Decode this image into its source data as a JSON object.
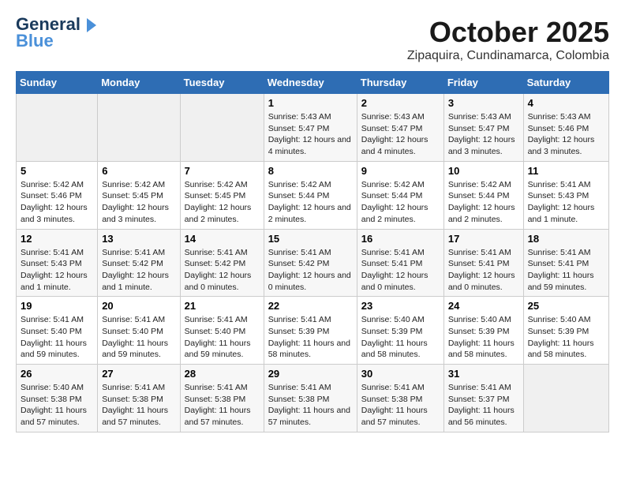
{
  "header": {
    "logo_line1": "General",
    "logo_line2": "Blue",
    "month_title": "October 2025",
    "location": "Zipaquira, Cundinamarca, Colombia"
  },
  "weekdays": [
    "Sunday",
    "Monday",
    "Tuesday",
    "Wednesday",
    "Thursday",
    "Friday",
    "Saturday"
  ],
  "weeks": [
    [
      {
        "day": "",
        "sunrise": "",
        "sunset": "",
        "daylight": ""
      },
      {
        "day": "",
        "sunrise": "",
        "sunset": "",
        "daylight": ""
      },
      {
        "day": "",
        "sunrise": "",
        "sunset": "",
        "daylight": ""
      },
      {
        "day": "1",
        "sunrise": "Sunrise: 5:43 AM",
        "sunset": "Sunset: 5:47 PM",
        "daylight": "Daylight: 12 hours and 4 minutes."
      },
      {
        "day": "2",
        "sunrise": "Sunrise: 5:43 AM",
        "sunset": "Sunset: 5:47 PM",
        "daylight": "Daylight: 12 hours and 4 minutes."
      },
      {
        "day": "3",
        "sunrise": "Sunrise: 5:43 AM",
        "sunset": "Sunset: 5:47 PM",
        "daylight": "Daylight: 12 hours and 3 minutes."
      },
      {
        "day": "4",
        "sunrise": "Sunrise: 5:43 AM",
        "sunset": "Sunset: 5:46 PM",
        "daylight": "Daylight: 12 hours and 3 minutes."
      }
    ],
    [
      {
        "day": "5",
        "sunrise": "Sunrise: 5:42 AM",
        "sunset": "Sunset: 5:46 PM",
        "daylight": "Daylight: 12 hours and 3 minutes."
      },
      {
        "day": "6",
        "sunrise": "Sunrise: 5:42 AM",
        "sunset": "Sunset: 5:45 PM",
        "daylight": "Daylight: 12 hours and 3 minutes."
      },
      {
        "day": "7",
        "sunrise": "Sunrise: 5:42 AM",
        "sunset": "Sunset: 5:45 PM",
        "daylight": "Daylight: 12 hours and 2 minutes."
      },
      {
        "day": "8",
        "sunrise": "Sunrise: 5:42 AM",
        "sunset": "Sunset: 5:44 PM",
        "daylight": "Daylight: 12 hours and 2 minutes."
      },
      {
        "day": "9",
        "sunrise": "Sunrise: 5:42 AM",
        "sunset": "Sunset: 5:44 PM",
        "daylight": "Daylight: 12 hours and 2 minutes."
      },
      {
        "day": "10",
        "sunrise": "Sunrise: 5:42 AM",
        "sunset": "Sunset: 5:44 PM",
        "daylight": "Daylight: 12 hours and 2 minutes."
      },
      {
        "day": "11",
        "sunrise": "Sunrise: 5:41 AM",
        "sunset": "Sunset: 5:43 PM",
        "daylight": "Daylight: 12 hours and 1 minute."
      }
    ],
    [
      {
        "day": "12",
        "sunrise": "Sunrise: 5:41 AM",
        "sunset": "Sunset: 5:43 PM",
        "daylight": "Daylight: 12 hours and 1 minute."
      },
      {
        "day": "13",
        "sunrise": "Sunrise: 5:41 AM",
        "sunset": "Sunset: 5:42 PM",
        "daylight": "Daylight: 12 hours and 1 minute."
      },
      {
        "day": "14",
        "sunrise": "Sunrise: 5:41 AM",
        "sunset": "Sunset: 5:42 PM",
        "daylight": "Daylight: 12 hours and 0 minutes."
      },
      {
        "day": "15",
        "sunrise": "Sunrise: 5:41 AM",
        "sunset": "Sunset: 5:42 PM",
        "daylight": "Daylight: 12 hours and 0 minutes."
      },
      {
        "day": "16",
        "sunrise": "Sunrise: 5:41 AM",
        "sunset": "Sunset: 5:41 PM",
        "daylight": "Daylight: 12 hours and 0 minutes."
      },
      {
        "day": "17",
        "sunrise": "Sunrise: 5:41 AM",
        "sunset": "Sunset: 5:41 PM",
        "daylight": "Daylight: 12 hours and 0 minutes."
      },
      {
        "day": "18",
        "sunrise": "Sunrise: 5:41 AM",
        "sunset": "Sunset: 5:41 PM",
        "daylight": "Daylight: 11 hours and 59 minutes."
      }
    ],
    [
      {
        "day": "19",
        "sunrise": "Sunrise: 5:41 AM",
        "sunset": "Sunset: 5:40 PM",
        "daylight": "Daylight: 11 hours and 59 minutes."
      },
      {
        "day": "20",
        "sunrise": "Sunrise: 5:41 AM",
        "sunset": "Sunset: 5:40 PM",
        "daylight": "Daylight: 11 hours and 59 minutes."
      },
      {
        "day": "21",
        "sunrise": "Sunrise: 5:41 AM",
        "sunset": "Sunset: 5:40 PM",
        "daylight": "Daylight: 11 hours and 59 minutes."
      },
      {
        "day": "22",
        "sunrise": "Sunrise: 5:41 AM",
        "sunset": "Sunset: 5:39 PM",
        "daylight": "Daylight: 11 hours and 58 minutes."
      },
      {
        "day": "23",
        "sunrise": "Sunrise: 5:40 AM",
        "sunset": "Sunset: 5:39 PM",
        "daylight": "Daylight: 11 hours and 58 minutes."
      },
      {
        "day": "24",
        "sunrise": "Sunrise: 5:40 AM",
        "sunset": "Sunset: 5:39 PM",
        "daylight": "Daylight: 11 hours and 58 minutes."
      },
      {
        "day": "25",
        "sunrise": "Sunrise: 5:40 AM",
        "sunset": "Sunset: 5:39 PM",
        "daylight": "Daylight: 11 hours and 58 minutes."
      }
    ],
    [
      {
        "day": "26",
        "sunrise": "Sunrise: 5:40 AM",
        "sunset": "Sunset: 5:38 PM",
        "daylight": "Daylight: 11 hours and 57 minutes."
      },
      {
        "day": "27",
        "sunrise": "Sunrise: 5:41 AM",
        "sunset": "Sunset: 5:38 PM",
        "daylight": "Daylight: 11 hours and 57 minutes."
      },
      {
        "day": "28",
        "sunrise": "Sunrise: 5:41 AM",
        "sunset": "Sunset: 5:38 PM",
        "daylight": "Daylight: 11 hours and 57 minutes."
      },
      {
        "day": "29",
        "sunrise": "Sunrise: 5:41 AM",
        "sunset": "Sunset: 5:38 PM",
        "daylight": "Daylight: 11 hours and 57 minutes."
      },
      {
        "day": "30",
        "sunrise": "Sunrise: 5:41 AM",
        "sunset": "Sunset: 5:38 PM",
        "daylight": "Daylight: 11 hours and 57 minutes."
      },
      {
        "day": "31",
        "sunrise": "Sunrise: 5:41 AM",
        "sunset": "Sunset: 5:37 PM",
        "daylight": "Daylight: 11 hours and 56 minutes."
      },
      {
        "day": "",
        "sunrise": "",
        "sunset": "",
        "daylight": ""
      }
    ]
  ]
}
